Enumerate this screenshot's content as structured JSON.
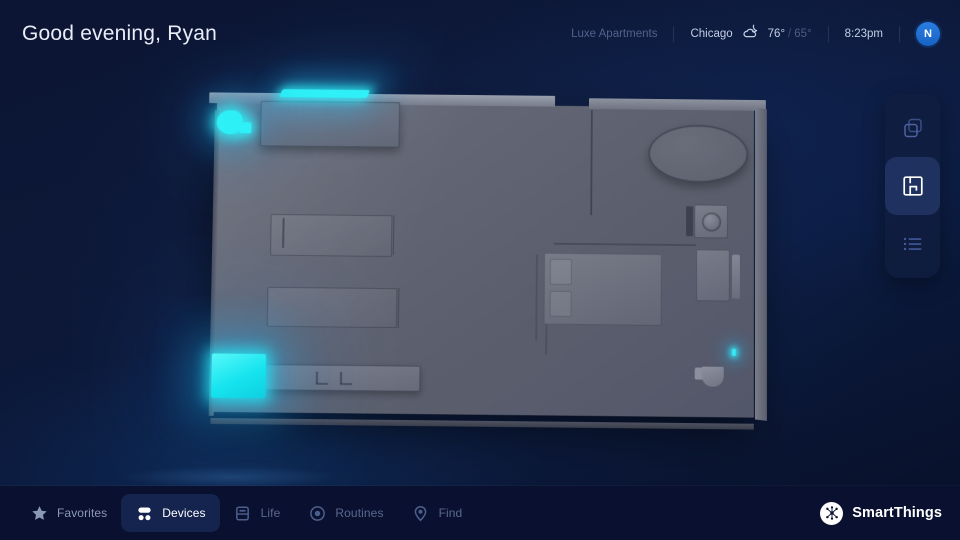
{
  "header": {
    "greeting": "Good evening, Ryan",
    "home_name": "Luxe Apartments",
    "city": "Chicago",
    "weather_icon": "cloud-moon-icon",
    "temp_high": "76°",
    "temp_separator": "/",
    "temp_low": "65°",
    "time": "8:23pm",
    "avatar_initial": "N",
    "avatar_color": "#1f6fd0"
  },
  "toolbar": {
    "items": [
      {
        "name": "layers-icon",
        "label": "Layers",
        "active": false
      },
      {
        "name": "floorplan-icon",
        "label": "Floor plan",
        "active": true
      },
      {
        "name": "list-icon",
        "label": "List",
        "active": false
      }
    ]
  },
  "nav": {
    "items": [
      {
        "label": "Favorites",
        "icon": "star-icon",
        "active": false
      },
      {
        "label": "Devices",
        "icon": "devices-icon",
        "active": true
      },
      {
        "label": "Life",
        "icon": "life-icon",
        "active": false
      },
      {
        "label": "Routines",
        "icon": "routines-icon",
        "active": false
      },
      {
        "label": "Find",
        "icon": "find-pin-icon",
        "active": false
      }
    ]
  },
  "brand": {
    "name": "SmartThings",
    "mark": "smartthings-hub-icon"
  },
  "floorplan": {
    "view": "3d-floor-plan",
    "accent_color": "#2ef0f6",
    "floor_color": "#63677f",
    "devices": [
      {
        "name": "light-strip",
        "state": "on",
        "color": "#2ef0f6"
      },
      {
        "name": "pendant-light",
        "state": "on",
        "color": "#2ef0f6"
      },
      {
        "name": "light-panel",
        "state": "on",
        "color": "#16e4ee"
      },
      {
        "name": "sensor-led",
        "state": "on",
        "color": "#36e8f2"
      }
    ],
    "furniture": [
      "kitchen-counter",
      "round-rug",
      "bed",
      "nightstand",
      "washer",
      "lower-counter",
      "toilet",
      "sofa"
    ]
  }
}
